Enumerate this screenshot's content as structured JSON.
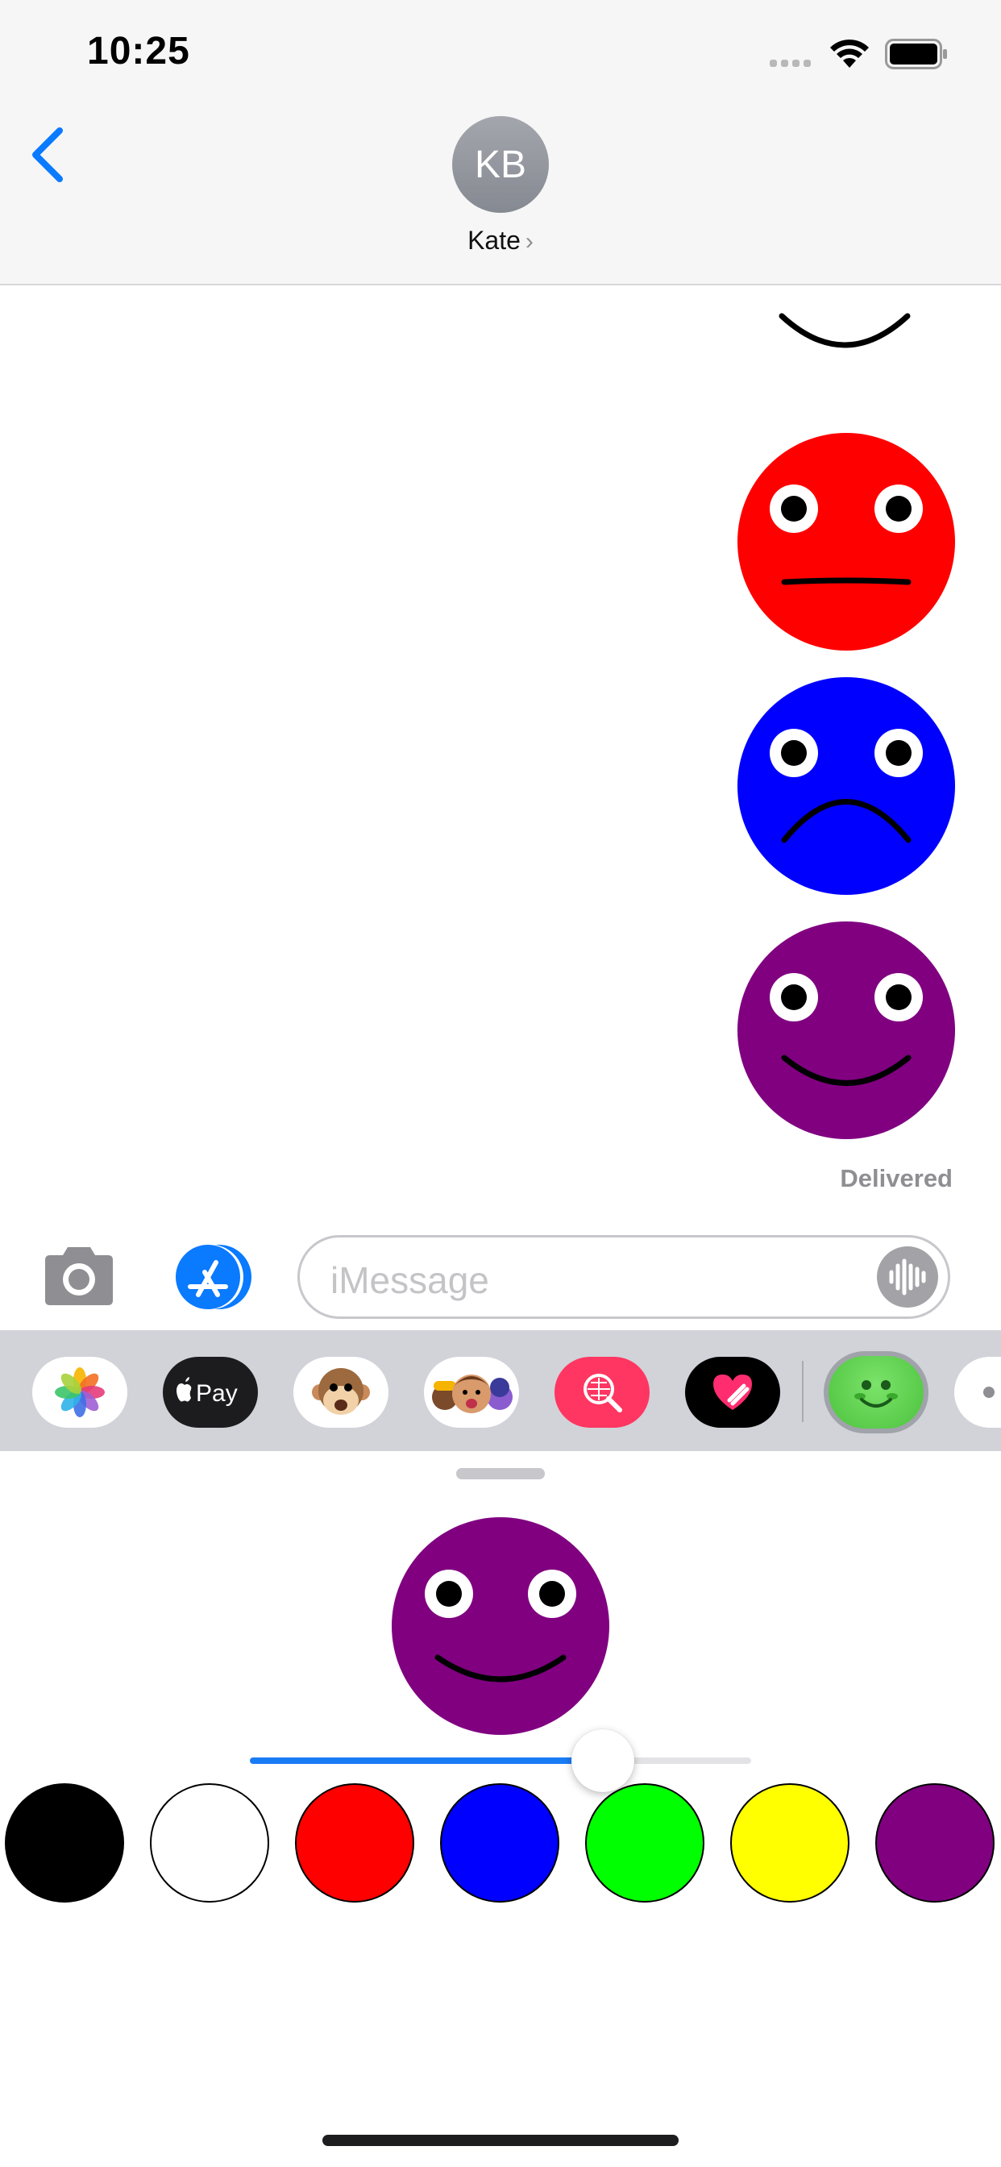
{
  "status_bar": {
    "time": "10:25",
    "signal_icon": "signal-dots-icon",
    "wifi_icon": "wifi-icon",
    "battery_icon": "battery-icon"
  },
  "header": {
    "avatar_initials": "KB",
    "contact_name": "Kate",
    "back_icon": "chevron-left-icon",
    "name_chevron": "›"
  },
  "conversation": {
    "stickers": [
      {
        "name": "partial-smile-sticker",
        "color": "#ffffff",
        "mouth": "smile"
      },
      {
        "name": "red-neutral-sticker",
        "color": "#ff0000",
        "mouth": "neutral"
      },
      {
        "name": "blue-frown-sticker",
        "color": "#0000ff",
        "mouth": "frown"
      },
      {
        "name": "purple-smile-sticker",
        "color": "#800080",
        "mouth": "smile"
      }
    ],
    "status": "Delivered"
  },
  "input_bar": {
    "placeholder": "iMessage",
    "camera_icon": "camera-icon",
    "appstore_icon": "app-store-icon",
    "audio_icon": "audio-waveform-icon"
  },
  "app_drawer": {
    "apps": [
      {
        "name": "photos-app-icon",
        "label": "Photos"
      },
      {
        "name": "apple-pay-app-icon",
        "label": "Pay"
      },
      {
        "name": "animoji-app-icon",
        "label": "Animoji"
      },
      {
        "name": "memoji-app-icon",
        "label": "Memoji"
      },
      {
        "name": "image-search-app-icon",
        "label": "Images"
      },
      {
        "name": "digital-touch-app-icon",
        "label": "Digital Touch"
      },
      {
        "name": "smiley-app-icon",
        "label": "Smiley"
      },
      {
        "name": "more-apps-icon",
        "label": "More"
      }
    ]
  },
  "editor": {
    "preview_color": "#800080",
    "preview_mouth": "smile",
    "slider_value": 0.7,
    "accent": "#1a7cf5",
    "swatches": [
      {
        "name": "black",
        "color": "#000000"
      },
      {
        "name": "white",
        "color": "#ffffff"
      },
      {
        "name": "red",
        "color": "#ff0000"
      },
      {
        "name": "blue",
        "color": "#0000ff"
      },
      {
        "name": "green",
        "color": "#00ff00"
      },
      {
        "name": "yellow",
        "color": "#ffff00"
      },
      {
        "name": "purple",
        "color": "#800080"
      }
    ]
  }
}
